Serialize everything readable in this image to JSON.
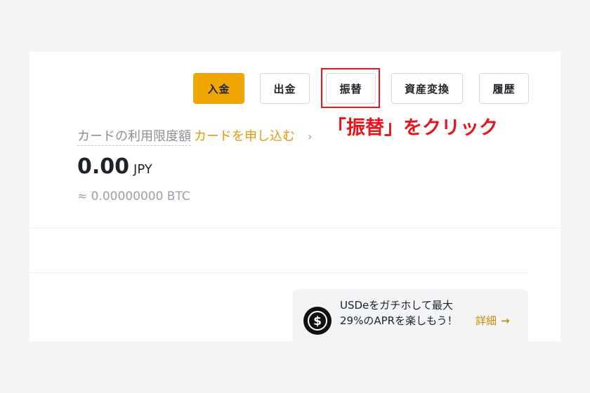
{
  "buttons": {
    "deposit": "入金",
    "withdraw": "出金",
    "transfer": "振替",
    "convert": "資産変換",
    "history": "履歴"
  },
  "instruction": "「振替」をクリック",
  "card_limit": {
    "label": "カードの利用限度額",
    "apply_link": "カードを申し込む",
    "chevron": "›"
  },
  "balance": {
    "amount": "0.00",
    "currency": "JPY",
    "btc_equivalent": "≈ 0.00000000 BTC"
  },
  "promo": {
    "icon": "usde-dollar-coin-icon",
    "text": "USDeをガチホして最大29%のAPRを楽しもう！",
    "link": "詳細",
    "arrow": "→"
  },
  "colors": {
    "primary": "#f0a600",
    "highlight": "#e8141c",
    "link": "#e09a0a"
  }
}
